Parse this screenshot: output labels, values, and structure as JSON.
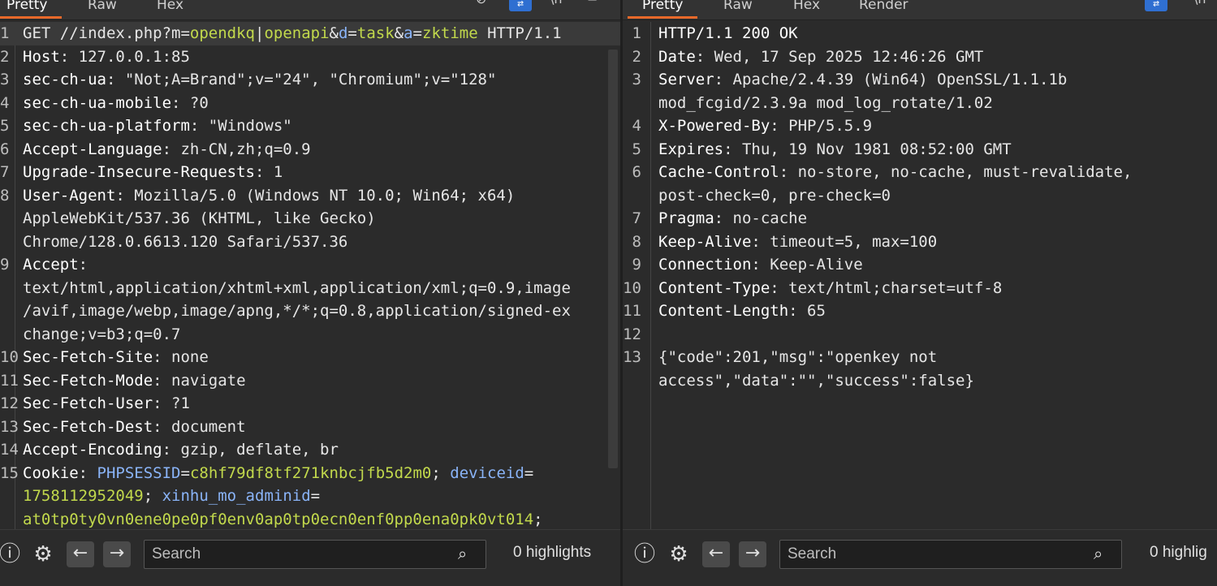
{
  "request": {
    "tabs": [
      "Pretty",
      "Raw",
      "Hex"
    ],
    "active_tab": "Pretty",
    "lines": [
      {
        "n": "1",
        "hl": true,
        "segs": [
          [
            "GET //index.php?m=",
            "val"
          ],
          [
            "opendkq",
            "grn"
          ],
          [
            "|",
            "val"
          ],
          [
            "openapi",
            "grn"
          ],
          [
            "&",
            "val"
          ],
          [
            "d",
            "blu"
          ],
          [
            "=",
            "val"
          ],
          [
            "task",
            "grn"
          ],
          [
            "&",
            "val"
          ],
          [
            "a",
            "blu"
          ],
          [
            "=",
            "val"
          ],
          [
            "zktime",
            "grn"
          ],
          [
            " HTTP/1.1",
            "val"
          ]
        ]
      },
      {
        "n": "2",
        "segs": [
          [
            "Host",
            "hk"
          ],
          [
            ": 127.0.0.1:85",
            "val"
          ]
        ]
      },
      {
        "n": "3",
        "segs": [
          [
            "sec-ch-ua",
            "hk"
          ],
          [
            ": \"Not;A=Brand\";v=\"24\", \"Chromium\";v=\"128\"",
            "val"
          ]
        ]
      },
      {
        "n": "4",
        "segs": [
          [
            "sec-ch-ua-mobile",
            "hk"
          ],
          [
            ": ?0",
            "val"
          ]
        ]
      },
      {
        "n": "5",
        "segs": [
          [
            "sec-ch-ua-platform",
            "hk"
          ],
          [
            ": \"Windows\"",
            "val"
          ]
        ]
      },
      {
        "n": "6",
        "segs": [
          [
            "Accept-Language",
            "hk"
          ],
          [
            ": zh-CN,zh;q=0.9",
            "val"
          ]
        ]
      },
      {
        "n": "7",
        "segs": [
          [
            "Upgrade-Insecure-Requests",
            "hk"
          ],
          [
            ": 1",
            "val"
          ]
        ]
      },
      {
        "n": "8",
        "segs": [
          [
            "User-Agent",
            "hk"
          ],
          [
            ": Mozilla/5.0 (Windows NT 10.0; Win64; x64)",
            "val"
          ]
        ]
      },
      {
        "n": "",
        "segs": [
          [
            "AppleWebKit/537.36 (KHTML, like Gecko)",
            "val"
          ]
        ]
      },
      {
        "n": "",
        "segs": [
          [
            "Chrome/128.0.6613.120 Safari/537.36",
            "val"
          ]
        ]
      },
      {
        "n": "9",
        "segs": [
          [
            "Accept",
            "hk"
          ],
          [
            ":",
            "val"
          ]
        ]
      },
      {
        "n": "",
        "segs": [
          [
            "text/html,application/xhtml+xml,application/xml;q=0.9,image",
            "val"
          ]
        ]
      },
      {
        "n": "",
        "segs": [
          [
            "/avif,image/webp,image/apng,*/*;q=0.8,application/signed-ex",
            "val"
          ]
        ]
      },
      {
        "n": "",
        "segs": [
          [
            "change;v=b3;q=0.7",
            "val"
          ]
        ]
      },
      {
        "n": "10",
        "segs": [
          [
            "Sec-Fetch-Site",
            "hk"
          ],
          [
            ": none",
            "val"
          ]
        ]
      },
      {
        "n": "11",
        "segs": [
          [
            "Sec-Fetch-Mode",
            "hk"
          ],
          [
            ": navigate",
            "val"
          ]
        ]
      },
      {
        "n": "12",
        "segs": [
          [
            "Sec-Fetch-User",
            "hk"
          ],
          [
            ": ?1",
            "val"
          ]
        ]
      },
      {
        "n": "13",
        "segs": [
          [
            "Sec-Fetch-Dest",
            "hk"
          ],
          [
            ": document",
            "val"
          ]
        ]
      },
      {
        "n": "14",
        "segs": [
          [
            "Accept-Encoding",
            "hk"
          ],
          [
            ": gzip, deflate, br",
            "val"
          ]
        ]
      },
      {
        "n": "15",
        "segs": [
          [
            "Cookie",
            "hk"
          ],
          [
            ": ",
            "val"
          ],
          [
            "PHPSESSID",
            "blu"
          ],
          [
            "=",
            "val"
          ],
          [
            "c8hf79df8tf271knbcjfb5d2m0",
            "grn"
          ],
          [
            "; ",
            "val"
          ],
          [
            "deviceid",
            "blu"
          ],
          [
            "=",
            "val"
          ]
        ]
      },
      {
        "n": "",
        "segs": [
          [
            "1758112952049",
            "grn"
          ],
          [
            "; ",
            "val"
          ],
          [
            "xinhu_mo_adminid",
            "blu"
          ],
          [
            "=",
            "val"
          ]
        ]
      },
      {
        "n": "",
        "segs": [
          [
            "at0tp0ty0vn0ene0pe0pf0env0ap0tp0ecn0enf0pp0ena0pk0vt014",
            "grn"
          ],
          [
            ";",
            "val"
          ]
        ]
      }
    ],
    "search_placeholder": "Search",
    "highlights": "0 highlights"
  },
  "response": {
    "tabs": [
      "Pretty",
      "Raw",
      "Hex",
      "Render"
    ],
    "active_tab": "Pretty",
    "lines": [
      {
        "n": "1",
        "segs": [
          [
            "HTTP/1.1 200 OK",
            "hk"
          ]
        ]
      },
      {
        "n": "2",
        "segs": [
          [
            "Date",
            "hk"
          ],
          [
            ": Wed, 17 Sep 2025 12:46:26 GMT",
            "val"
          ]
        ]
      },
      {
        "n": "3",
        "segs": [
          [
            "Server",
            "hk"
          ],
          [
            ": Apache/2.4.39 (Win64) OpenSSL/1.1.1b",
            "val"
          ]
        ]
      },
      {
        "n": "",
        "segs": [
          [
            "mod_fcgid/2.3.9a mod_log_rotate/1.02",
            "val"
          ]
        ]
      },
      {
        "n": "4",
        "segs": [
          [
            "X-Powered-By",
            "hk"
          ],
          [
            ": PHP/5.5.9",
            "val"
          ]
        ]
      },
      {
        "n": "5",
        "segs": [
          [
            "Expires",
            "hk"
          ],
          [
            ": Thu, 19 Nov 1981 08:52:00 GMT",
            "val"
          ]
        ]
      },
      {
        "n": "6",
        "segs": [
          [
            "Cache-Control",
            "hk"
          ],
          [
            ": no-store, no-cache, must-revalidate,",
            "val"
          ]
        ]
      },
      {
        "n": "",
        "segs": [
          [
            "post-check=0, pre-check=0",
            "val"
          ]
        ]
      },
      {
        "n": "7",
        "segs": [
          [
            "Pragma",
            "hk"
          ],
          [
            ": no-cache",
            "val"
          ]
        ]
      },
      {
        "n": "8",
        "segs": [
          [
            "Keep-Alive",
            "hk"
          ],
          [
            ": timeout=5, max=100",
            "val"
          ]
        ]
      },
      {
        "n": "9",
        "segs": [
          [
            "Connection",
            "hk"
          ],
          [
            ": Keep-Alive",
            "val"
          ]
        ]
      },
      {
        "n": "10",
        "segs": [
          [
            "Content-Type",
            "hk"
          ],
          [
            ": text/html;charset=utf-8",
            "val"
          ]
        ]
      },
      {
        "n": "11",
        "segs": [
          [
            "Content-Length",
            "hk"
          ],
          [
            ": 65",
            "val"
          ]
        ]
      },
      {
        "n": "12",
        "segs": [
          [
            "",
            "val"
          ]
        ]
      },
      {
        "n": "13",
        "segs": [
          [
            "{\"code\":201,\"msg\":\"openkey not",
            "val"
          ]
        ]
      },
      {
        "n": "",
        "segs": [
          [
            "access\",\"data\":\"\",\"success\":false}",
            "val"
          ]
        ]
      }
    ],
    "search_placeholder": "Search",
    "highlights": "0 highlig"
  },
  "icons": {
    "settings": "gear-icon",
    "help": "help-icon",
    "prev": "arrow-left-icon",
    "next": "arrow-right-icon",
    "search": "search-icon"
  }
}
